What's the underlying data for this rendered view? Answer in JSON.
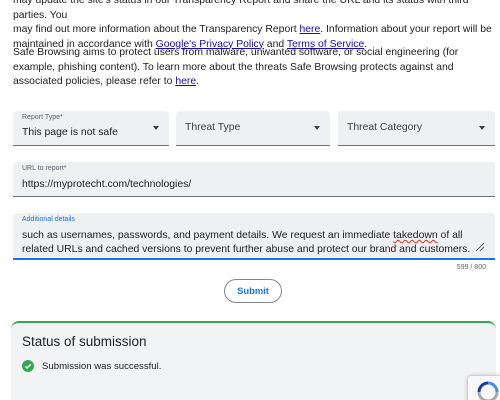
{
  "intro": {
    "line1": "may update the site's status in our Transparency Report and share the URL and its status with third parties. You",
    "line2_before": "may find out more information about the Transparency Report ",
    "transparency_link": "here",
    "line2_after": ". Information about your report will be",
    "line3_before": "maintained in accordance with ",
    "privacy_link": "Google's Privacy Policy",
    "line3_mid": " and ",
    "terms_link": "Terms of Service",
    "line3_after": "."
  },
  "safe_browsing": {
    "text": "Safe Browsing aims to protect users from malware, unwanted software, or social engineering (for example, phishing content). To learn more about the threats Safe Browsing protects against and associated policies, please refer to ",
    "link": "here",
    "after": "."
  },
  "form": {
    "report_type": {
      "label": "Report Type*",
      "value": "This page is not safe"
    },
    "threat_type": {
      "placeholder": "Threat Type"
    },
    "threat_category": {
      "placeholder": "Threat Category"
    },
    "url": {
      "label": "URL to report*",
      "value": "https://myprotecht.com/technologies/"
    },
    "details": {
      "label": "Additional details",
      "text_before": "such as usernames, passwords, and payment details. We request an immediate ",
      "misspelled": "takedown",
      "text_after": " of all related URLs and cached versions to prevent further abuse and protect our brand and customers."
    },
    "counter": "599 / 800",
    "submit_label": "Submit"
  },
  "status": {
    "title": "Status of submission",
    "message": "Submission was successful.",
    "accent_color": "#34a853"
  },
  "colors": {
    "link": "#1a0dab",
    "primary": "#1a73e8"
  }
}
